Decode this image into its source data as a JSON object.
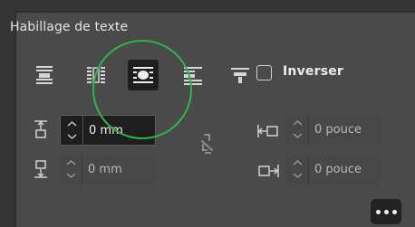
{
  "panel": {
    "title": "Habillage de texte"
  },
  "wrap_options": [
    {
      "icon": "no-wrap-icon",
      "selected": false
    },
    {
      "icon": "wrap-bounding-box-icon",
      "selected": false
    },
    {
      "icon": "wrap-object-shape-icon",
      "selected": true
    },
    {
      "icon": "jump-object-icon",
      "selected": false
    },
    {
      "icon": "jump-to-next-column-icon",
      "selected": false
    }
  ],
  "invert": {
    "label": "Inverser",
    "checked": false
  },
  "offsets": {
    "top": {
      "value": "0 mm",
      "icon": "top-offset-icon",
      "active": true
    },
    "bottom": {
      "value": "0 mm",
      "icon": "bottom-offset-icon",
      "active": false
    },
    "left": {
      "value": "0 pouce",
      "icon": "left-offset-icon",
      "active": false
    },
    "right": {
      "value": "0 pouce",
      "icon": "right-offset-icon",
      "active": false
    }
  },
  "link_icon": "unlink-icon",
  "more_icon": "more-options-icon",
  "colors": {
    "panel_bg": "#4a4a4a",
    "selected_bg": "#1e1e1e",
    "annotation": "#31b44a"
  }
}
